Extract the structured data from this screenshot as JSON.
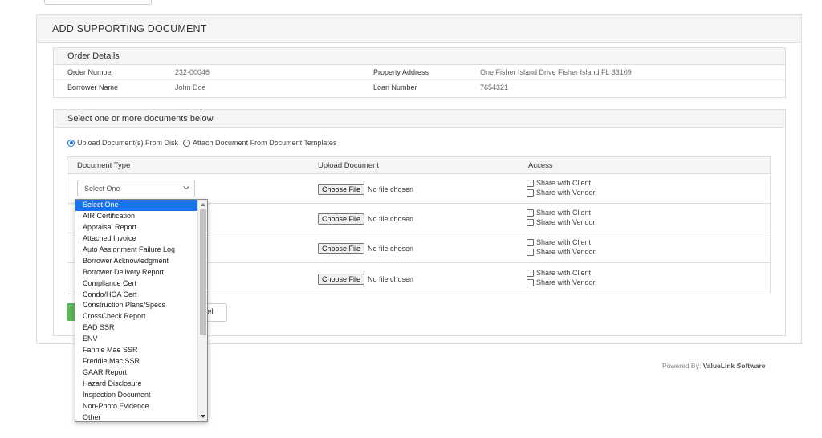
{
  "title": "ADD SUPPORTING DOCUMENT",
  "order_details": {
    "heading": "Order Details",
    "order_number_label": "Order Number",
    "order_number": "232-00046",
    "property_address_label": "Property Address",
    "property_address": "One Fisher Island Drive Fisher Island FL 33109",
    "borrower_name_label": "Borrower Name",
    "borrower_name": "John Doe",
    "loan_number_label": "Loan Number",
    "loan_number": "7654321"
  },
  "documents": {
    "heading": "Select one or more documents below",
    "radio_upload": "Upload Document(s) From Disk",
    "radio_templates": "Attach Document From Document Templates",
    "col_type": "Document Type",
    "col_upload": "Upload Document",
    "col_access": "Access",
    "select_value": "Select One",
    "choose_file": "Choose File",
    "no_file": "No file chosen",
    "share_client": "Share with Client",
    "share_vendor": "Share with Vendor"
  },
  "buttons": {
    "cancel_partial": "el"
  },
  "footer": {
    "powered_prefix": "Powered By: ",
    "powered_brand": "ValueLink Software"
  },
  "dropdown": {
    "options": [
      "Select One",
      "AIR Certification",
      "Appraisal Report",
      "Attached Invoice",
      "Auto Assignment Failure Log",
      "Borrower Acknowledgment",
      "Borrower Delivery Report",
      "Compliance Cert",
      "Condo/HOA Cert",
      "Construction Plans/Specs",
      "CrossCheck Report",
      "EAD SSR",
      "ENV",
      "Fannie Mae SSR",
      "Freddie Mac SSR",
      "GAAR Report",
      "Hazard Disclosure",
      "Inspection Document",
      "Non-Photo Evidence",
      "Other"
    ]
  },
  "colors": {
    "accent_blue": "#1a73e8",
    "save_green": "#5cb85c",
    "panel_header": "#f5f5f5",
    "border": "#dddddd"
  }
}
